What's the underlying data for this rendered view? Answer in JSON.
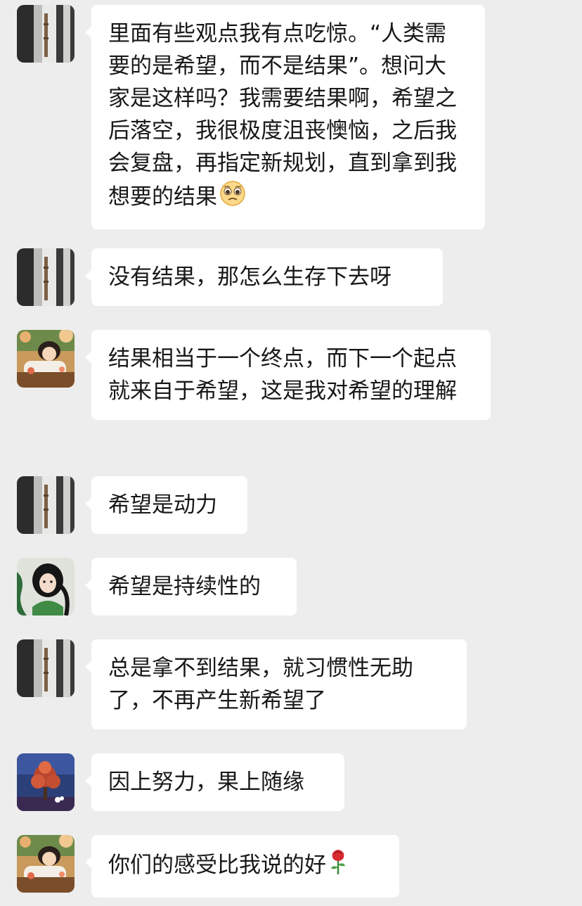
{
  "messages": [
    {
      "avatar": "avatar-bamboo-shadow",
      "text": "里面有些观点我有点吃惊。“人类需要的是希望，而不是结果”。想问大家是这样吗？我需要结果啊，希望之后落空，我很极度沮丧懊恼，之后我会复盘，再指定新规划，直到拿到我想要的结果",
      "emoji": "pleading-face-emoji"
    },
    {
      "avatar": "avatar-bamboo-shadow",
      "text": "没有结果，那怎么生存下去呀"
    },
    {
      "avatar": "avatar-anime-girl-flowers",
      "text": "结果相当于一个终点，而下一个起点就来自于希望，这是我对希望的理解"
    },
    {
      "avatar": "avatar-bamboo-shadow",
      "text": "希望是动力"
    },
    {
      "avatar": "avatar-anime-girl-green",
      "text": "希望是持续性的"
    },
    {
      "avatar": "avatar-bamboo-shadow",
      "text": "总是拿不到结果，就习惯性无助了，不再产生新希望了"
    },
    {
      "avatar": "avatar-tree-night",
      "text": "因上努力，果上随缘"
    },
    {
      "avatar": "avatar-anime-girl-flowers",
      "text": "你们的感受比我说的好",
      "emoji": "rose-emoji"
    }
  ],
  "colors": {
    "background": "#ededed",
    "bubble": "#ffffff",
    "text": "#181818"
  }
}
